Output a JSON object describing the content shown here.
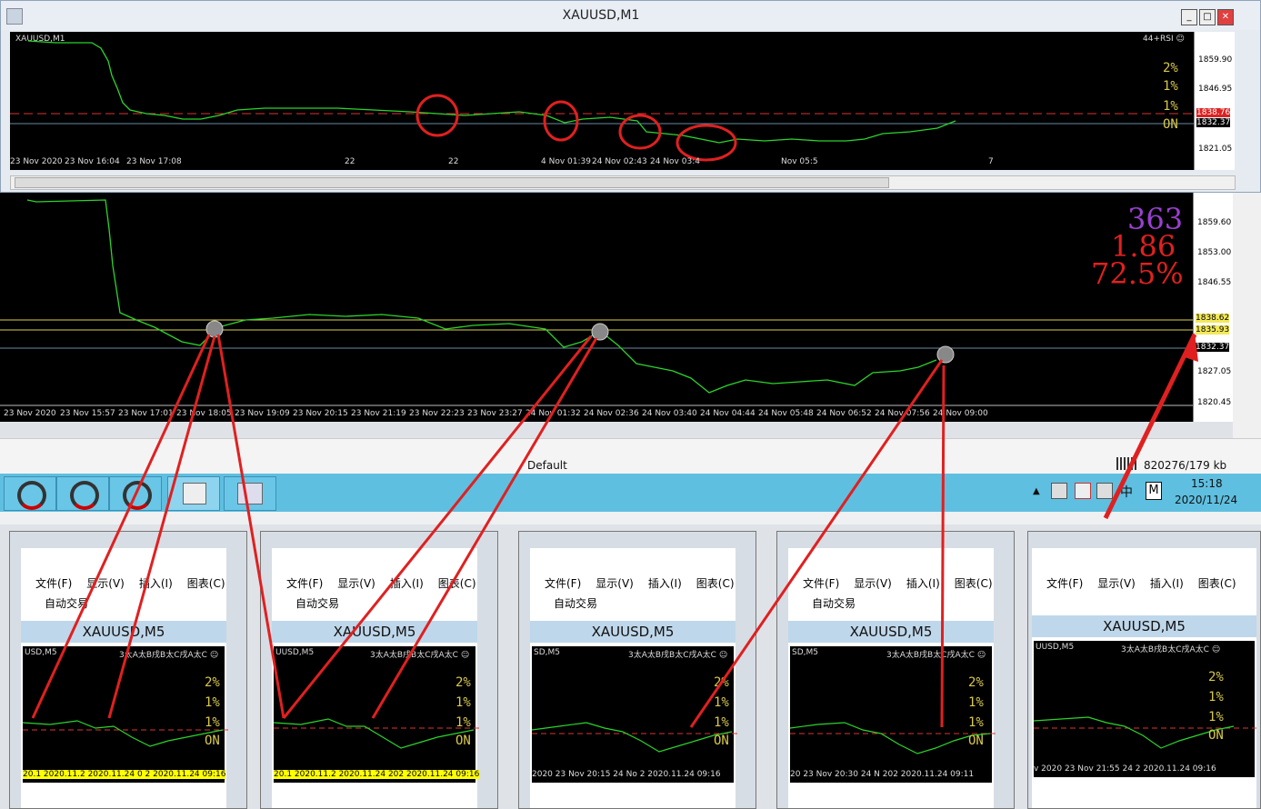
{
  "main_window": {
    "title": "XAUUSD,M1",
    "chart_label": "XAUUSD,M1",
    "indicator_label": "44+RSI ☺",
    "price_ticks": [
      "1859.90",
      "1846.95",
      "1838.76",
      "1832.37",
      "1821.05"
    ],
    "level_labels": [
      "2%",
      "1%",
      "1%",
      "ON"
    ],
    "x_ticks": [
      "23 Nov 2020",
      "23 Nov 16:04",
      "23 Nov 17:08",
      "22",
      "22",
      "4 Nov 01:39",
      "24 Nov 02:43",
      "24 Nov 03:4",
      "Nov 05:5",
      "7"
    ]
  },
  "lower_chart": {
    "big_numbers": [
      "363",
      "1.86",
      "72.5%"
    ],
    "price_ticks": [
      "1859.60",
      "1853.00",
      "1846.55",
      "1838.62",
      "1835.93",
      "1832.37",
      "1827.05",
      "1820.45"
    ],
    "x_ticks": [
      "23 Nov 2020",
      "23 Nov 15:57",
      "23 Nov 17:01",
      "23 Nov 18:05",
      "23 Nov 19:09",
      "23 Nov 20:15",
      "23 Nov 21:19",
      "23 Nov 22:23",
      "23 Nov 23:27",
      "24 Nov 01:32",
      "24 Nov 02:36",
      "24 Nov 03:40",
      "24 Nov 04:44",
      "24 Nov 05:48",
      "24 Nov 06:52",
      "24 Nov 07:56",
      "24 Nov 09:00"
    ]
  },
  "status_bar": {
    "profile": "Default",
    "traffic": "820276/179 kb"
  },
  "taskbar": {
    "time": "15:18",
    "date": "2020/11/24",
    "ime": "中",
    "m": "M"
  },
  "mini_windows": [
    {
      "menu": [
        "文件(F)",
        "显示(V)",
        "插入(I)",
        "图表(C)"
      ],
      "auto_trade": "自动交易",
      "title": "XAUUSD,M5",
      "chart_label": "USD,M5",
      "ind": "3太A太B戌B太C戌A太C ☺",
      "levels": [
        "2%",
        "1%",
        "1%",
        "ON"
      ],
      "date_strip": "20.1 2020.11.2 2020.11.24 0 2 2020.11.24 09:16"
    },
    {
      "menu": [
        "文件(F)",
        "显示(V)",
        "插入(I)",
        "图表(C)"
      ],
      "auto_trade": "自动交易",
      "title": "XAUUSD,M5",
      "chart_label": "UUSD,M5",
      "ind": "3太A太B戌B太C戌A太C ☺",
      "levels": [
        "2%",
        "1%",
        "1%",
        "ON"
      ],
      "date_strip": "20.1 2020.11.2 2020.11.24 202 2020.11.24 09:16"
    },
    {
      "menu": [
        "文件(F)",
        "显示(V)",
        "插入(I)",
        "图表(C)"
      ],
      "auto_trade": "自动交易",
      "title": "XAUUSD,M5",
      "chart_label": "SD,M5",
      "ind": "3太A太B戌B太C戌A太C ☺",
      "levels": [
        "2%",
        "1%",
        "1%",
        "ON"
      ],
      "date_strip": "2020  23 Nov 20:15  24 No 2 2020.11.24 09:16"
    },
    {
      "menu": [
        "文件(F)",
        "显示(V)",
        "插入(I)",
        "图表(C)"
      ],
      "auto_trade": "自动交易",
      "title": "XAUUSD,M5",
      "chart_label": "SD,M5",
      "ind": "3太A太B戌B太C戌A太C ☺",
      "levels": [
        "2%",
        "1%",
        "1%",
        "ON"
      ],
      "date_strip": "20  23 Nov 20:30  24 N 202 2020.11.24 09:11"
    },
    {
      "menu": [
        "文件(F)",
        "显示(V)",
        "插入(I)",
        "图表(C)"
      ],
      "auto_trade": "",
      "title": "XAUUSD,M5",
      "chart_label": "UUSD,M5",
      "ind": "3太A太B戌B太C戌A太C ☺",
      "levels": [
        "2%",
        "1%",
        "1%",
        "ON"
      ],
      "date_strip": "v 2020  23 Nov 21:55  24  2 2020.11.24 09:16"
    }
  ]
}
